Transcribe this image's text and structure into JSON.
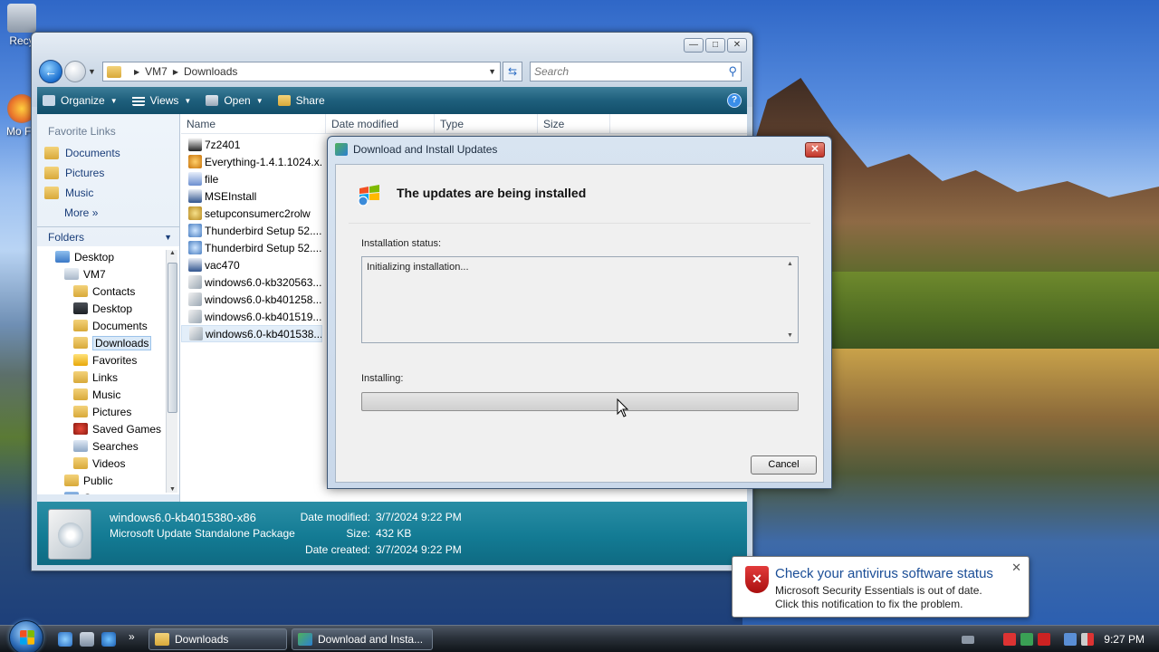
{
  "desktop": {
    "icons": [
      {
        "label": "Recy",
        "color": "#9aa6b4"
      },
      {
        "label": "Mo Fir",
        "color": "#e8702a"
      }
    ]
  },
  "explorer": {
    "address": {
      "crumbs": [
        "VM7",
        "Downloads"
      ]
    },
    "search_placeholder": "Search",
    "toolbar": {
      "organize": "Organize",
      "views": "Views",
      "open": "Open",
      "share": "Share",
      "help": "?"
    },
    "nav": {
      "favorites_header": "Favorite Links",
      "favorites": [
        "Documents",
        "Pictures",
        "Music"
      ],
      "more": "More",
      "folders_header": "Folders",
      "tree": [
        {
          "label": "Desktop",
          "indent": 0,
          "icon": "desktop-icon"
        },
        {
          "label": "VM7",
          "indent": 1,
          "icon": "user-folder-icon"
        },
        {
          "label": "Contacts",
          "indent": 2,
          "icon": "folder-icon"
        },
        {
          "label": "Desktop",
          "indent": 2,
          "icon": "monitor-icon"
        },
        {
          "label": "Documents",
          "indent": 2,
          "icon": "folder-icon"
        },
        {
          "label": "Downloads",
          "indent": 2,
          "icon": "folder-icon",
          "selected": true
        },
        {
          "label": "Favorites",
          "indent": 2,
          "icon": "star-icon"
        },
        {
          "label": "Links",
          "indent": 2,
          "icon": "folder-icon"
        },
        {
          "label": "Music",
          "indent": 2,
          "icon": "folder-icon"
        },
        {
          "label": "Pictures",
          "indent": 2,
          "icon": "folder-icon"
        },
        {
          "label": "Saved Games",
          "indent": 2,
          "icon": "game-icon"
        },
        {
          "label": "Searches",
          "indent": 2,
          "icon": "search-icon"
        },
        {
          "label": "Videos",
          "indent": 2,
          "icon": "folder-icon"
        },
        {
          "label": "Public",
          "indent": 1,
          "icon": "folder-icon"
        },
        {
          "label": "Computer",
          "indent": 1,
          "icon": "computer-icon"
        }
      ]
    },
    "columns": [
      "Name",
      "Date modified",
      "Type",
      "Size"
    ],
    "files": [
      {
        "name": "7z2401",
        "icon": "7z-icon"
      },
      {
        "name": "Everything-1.4.1.1024.x...",
        "icon": "magnifier-icon"
      },
      {
        "name": "file",
        "icon": "script-icon"
      },
      {
        "name": "MSEInstall",
        "icon": "installer-icon"
      },
      {
        "name": "setupconsumerc2rolw",
        "icon": "setup-icon"
      },
      {
        "name": "Thunderbird Setup 52....",
        "icon": "thunderbird-icon"
      },
      {
        "name": "Thunderbird Setup 52....",
        "icon": "thunderbird-icon"
      },
      {
        "name": "vac470",
        "icon": "installer-icon"
      },
      {
        "name": "windows6.0-kb320563...",
        "icon": "update-package-icon"
      },
      {
        "name": "windows6.0-kb401258...",
        "icon": "update-package-icon"
      },
      {
        "name": "windows6.0-kb401519...",
        "icon": "update-package-icon"
      },
      {
        "name": "windows6.0-kb401538...",
        "icon": "update-package-icon",
        "selected": true
      }
    ],
    "details": {
      "name": "windows6.0-kb4015380-x86",
      "type": "Microsoft Update Standalone Package",
      "date_modified_label": "Date modified:",
      "date_modified": "3/7/2024 9:22 PM",
      "size_label": "Size:",
      "size": "432 KB",
      "date_created_label": "Date created:",
      "date_created": "3/7/2024 9:22 PM"
    }
  },
  "dialog": {
    "title": "Download and Install Updates",
    "heading": "The updates are being installed",
    "status_label": "Installation status:",
    "status_text": "Initializing installation...",
    "installing_label": "Installing:",
    "progress": 0,
    "cancel_label": "Cancel"
  },
  "notification": {
    "title": "Check your antivirus software status",
    "line1": "Microsoft Security Essentials is out of date.",
    "line2": "Click this notification to fix the problem."
  },
  "taskbar": {
    "tasks": [
      "Downloads",
      "Download and Insta..."
    ],
    "clock": "9:27 PM",
    "quick_launch_more": "»"
  },
  "colors": {
    "toolbar": "#1e5f7c",
    "details_pane": "#137b94",
    "link": "#1a3e7a",
    "alert_red": "#c2352a"
  }
}
